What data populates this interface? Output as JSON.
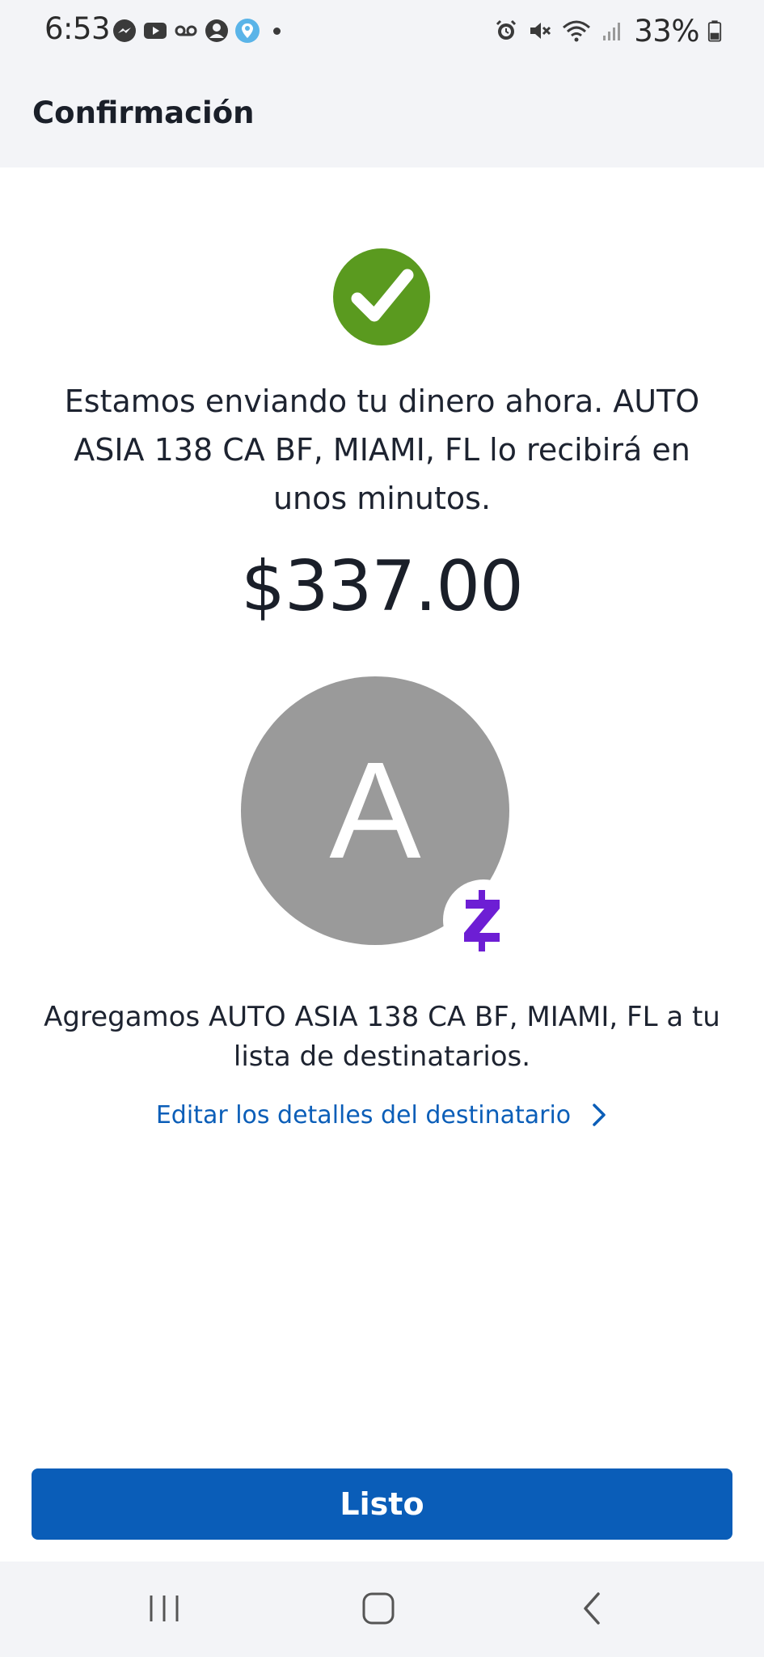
{
  "status_bar": {
    "time": "6:53",
    "battery_percent": "33%",
    "left_icons": [
      "messenger-icon",
      "youtube-icon",
      "voicemail-icon",
      "account-icon",
      "location-icon",
      "notification-dot"
    ],
    "right_icons": [
      "alarm-icon",
      "mute-icon",
      "wifi-icon",
      "signal-icon",
      "battery-icon"
    ]
  },
  "header": {
    "title": "Confirmación"
  },
  "confirmation": {
    "icon": "check-circle-icon",
    "message": "Estamos enviando tu dinero ahora. AUTO ASIA 138 CA BF, MIAMI, FL lo recibirá en unos minutos.",
    "amount": "$337.00"
  },
  "recipient": {
    "avatar_letter": "A",
    "badge_icon": "zelle-icon",
    "note": "Agregamos AUTO ASIA 138 CA BF, MIAMI, FL a tu lista de destinatarios.",
    "edit_link_label": "Editar los detalles del destinatario"
  },
  "actions": {
    "done_label": "Listo"
  },
  "nav_bar": {
    "buttons": [
      "recent-apps-icon",
      "home-icon",
      "back-icon"
    ]
  },
  "colors": {
    "success_green": "#5a9a1f",
    "primary_blue": "#0a5db8",
    "link_blue": "#0b5eb8",
    "zelle_purple": "#6d1ed4",
    "avatar_gray": "#9a9a9a",
    "header_bg": "#f3f4f7"
  }
}
